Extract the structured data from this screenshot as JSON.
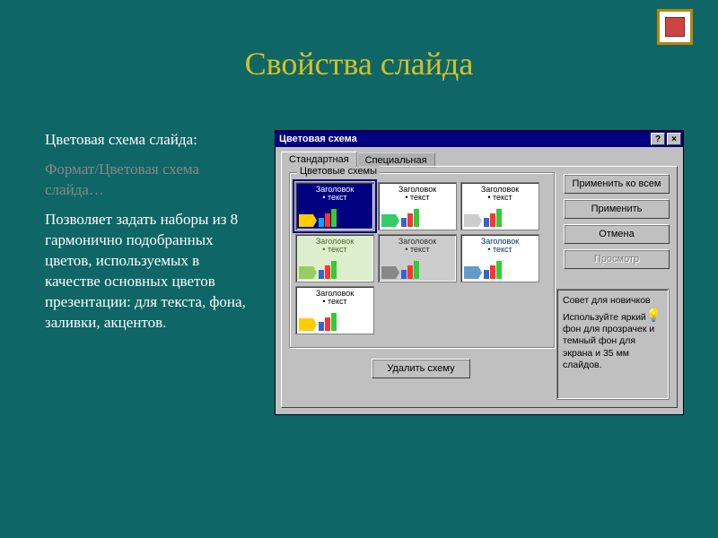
{
  "page": {
    "title": "Свойства слайда"
  },
  "left": {
    "line1": "Цветовая схема слайда:",
    "line2": "Формат/Цветовая схема слайда…",
    "body": "Позволяет задать наборы из 8 гармонично подобранных цветов, используемых в качестве основных цветов презентации: для текста, фона, заливки, акцентов."
  },
  "dialog": {
    "title": "Цветовая схема",
    "help_btn": "?",
    "close_btn": "×",
    "tabs": {
      "standard": "Стандартная",
      "custom": "Специальная"
    },
    "groupbox_label": "Цветовые схемы",
    "buttons": {
      "apply_all": "Применить ко всем",
      "apply": "Применить",
      "cancel": "Отмена",
      "preview": "Просмотр",
      "delete": "Удалить схему"
    },
    "tip": {
      "title": "Совет для новичков",
      "body": "Используйте яркий фон для прозрачек и темный фон для экрана и 35 мм слайдов."
    },
    "schemes": [
      {
        "bg": "#000080",
        "fg": "#ffffff",
        "title": "Заголовок",
        "text": "текст",
        "selected": true,
        "shape_bg": "#ffcc00",
        "bars": [
          "#00aaff",
          "#ff3333",
          "#33cc33"
        ]
      },
      {
        "bg": "#ffffff",
        "fg": "#000000",
        "title": "Заголовок",
        "text": "текст",
        "selected": false,
        "shape_bg": "#33cc66",
        "bars": [
          "#3366cc",
          "#ff3333",
          "#33cc33"
        ]
      },
      {
        "bg": "#ffffff",
        "fg": "#000000",
        "title": "Заголовок",
        "text": "текст",
        "selected": false,
        "shape_bg": "#cccccc",
        "bars": [
          "#3366cc",
          "#ff3333",
          "#33cc33"
        ]
      },
      {
        "bg": "#ddeecc",
        "fg": "#556633",
        "title": "Заголовок",
        "text": "текст",
        "selected": false,
        "shape_bg": "#99cc66",
        "bars": [
          "#3366cc",
          "#ff3333",
          "#33cc33"
        ]
      },
      {
        "bg": "#cccccc",
        "fg": "#333333",
        "title": "Заголовок",
        "text": "текст",
        "selected": false,
        "shape_bg": "#888888",
        "bars": [
          "#3366cc",
          "#ff3333",
          "#33cc33"
        ]
      },
      {
        "bg": "#ffffff",
        "fg": "#003366",
        "title": "Заголовок",
        "text": "текст",
        "selected": false,
        "shape_bg": "#6699cc",
        "bars": [
          "#3366cc",
          "#ff3333",
          "#33cc33"
        ]
      },
      {
        "bg": "#ffffff",
        "fg": "#000000",
        "title": "Заголовок",
        "text": "текст",
        "selected": false,
        "shape_bg": "#ffcc00",
        "bars": [
          "#3366cc",
          "#ff3333",
          "#33cc33"
        ]
      }
    ]
  }
}
